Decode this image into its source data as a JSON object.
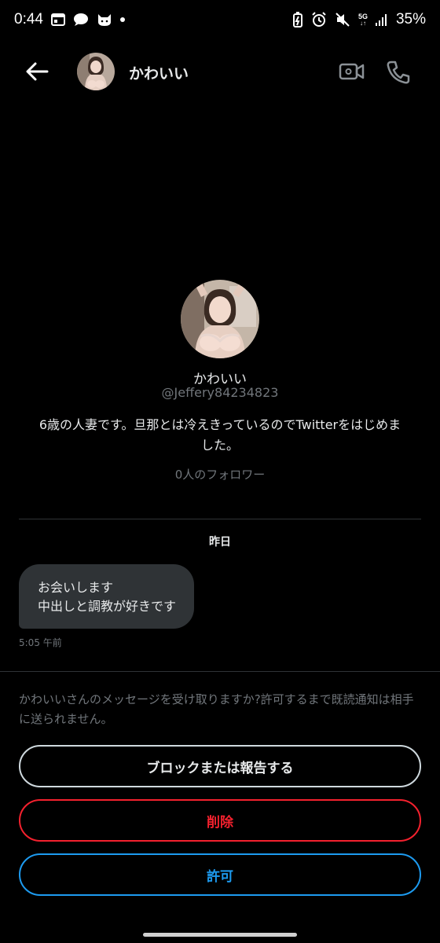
{
  "status_bar": {
    "time": "0:44",
    "network": "5G",
    "battery": "35%"
  },
  "header": {
    "name": "かわいい"
  },
  "profile": {
    "name": "かわいい",
    "handle": "@Jeffery84234823",
    "bio": "6歳の人妻です。旦那とは冷えきっているのでTwitterをはじめました。",
    "followers": "0人のフォロワー"
  },
  "conversation": {
    "date_label": "昨日",
    "messages": [
      {
        "lines": [
          "お会いします",
          "中出しと調教が好きです"
        ],
        "time": "5:05 午前"
      }
    ]
  },
  "request": {
    "notice": "かわいいさんのメッセージを受け取りますか?許可するまで既読通知は相手に送られません。",
    "block_label": "ブロックまたは報告する",
    "delete_label": "削除",
    "allow_label": "許可"
  },
  "colors": {
    "background": "#000000",
    "bubble": "#2f3336",
    "muted_text": "#71767b",
    "danger": "#f4212e",
    "accent": "#1d9bf0"
  }
}
